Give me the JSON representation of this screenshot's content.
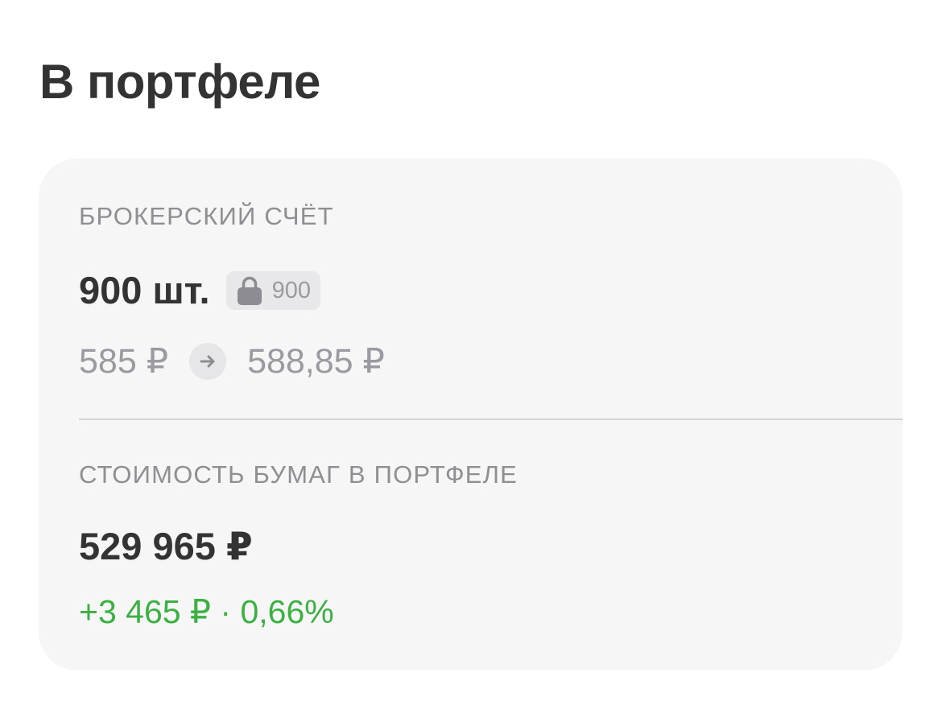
{
  "header": {
    "title": "В портфеле"
  },
  "account": {
    "label": "БРОКЕРСКИЙ СЧЁТ",
    "quantity": "900 шт.",
    "locked_icon": "lock-icon",
    "locked_quantity": "900",
    "price_from": "585 ₽",
    "price_arrow_icon": "arrow-right-icon",
    "price_to": "588,85 ₽"
  },
  "portfolio": {
    "label": "СТОИМОСТЬ БУМАГ В ПОРТФЕЛЕ",
    "total_value": "529 965 ₽",
    "change": "+3 465 ₽ · 0,66%"
  },
  "colors": {
    "positive": "#3cb043",
    "muted": "#9a9aa0",
    "card_bg": "#f6f6f6"
  }
}
